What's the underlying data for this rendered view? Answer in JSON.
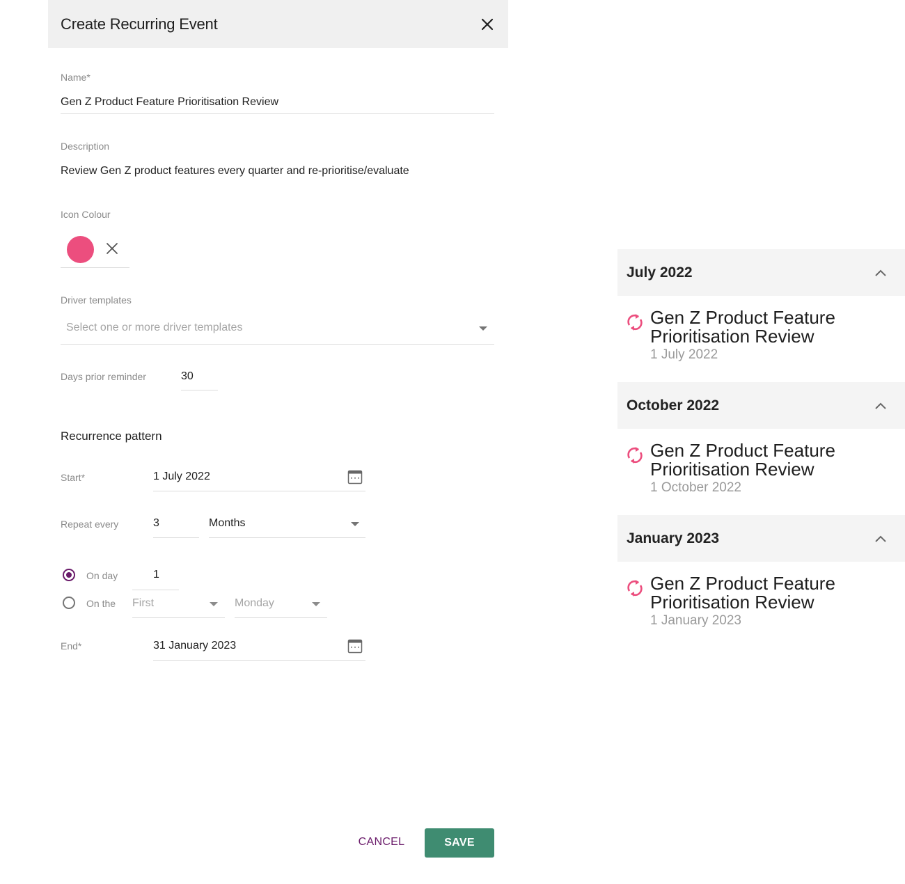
{
  "dialog": {
    "title": "Create Recurring Event",
    "close_icon": "close-icon",
    "name": {
      "label": "Name*",
      "value": "Gen Z Product Feature Prioritisation Review"
    },
    "description": {
      "label": "Description",
      "value": "Review Gen Z product features every quarter and re-prioritise/evaluate"
    },
    "icon_colour": {
      "label": "Icon Colour",
      "value": "#ec4e7e",
      "clear_icon": "close-icon"
    },
    "driver_templates": {
      "label": "Driver templates",
      "placeholder": "Select one or more driver templates"
    },
    "days_prior_reminder": {
      "label": "Days prior reminder",
      "value": "30"
    },
    "recurrence": {
      "title": "Recurrence pattern",
      "start": {
        "label": "Start*",
        "value": "1 July 2022"
      },
      "repeat_every": {
        "label": "Repeat every",
        "value": "3",
        "unit": "Months"
      },
      "on_day": {
        "label": "On day",
        "value": "1",
        "selected": true
      },
      "on_the": {
        "label": "On the",
        "ordinal": "First",
        "weekday": "Monday",
        "selected": false
      },
      "end": {
        "label": "End*",
        "value": "31 January 2023"
      }
    },
    "actions": {
      "cancel": "CANCEL",
      "save": "SAVE"
    },
    "colors": {
      "accent": "#6a1b6a",
      "save": "#3f8c71",
      "header_bg": "#f0f0f0"
    }
  },
  "timeline": {
    "groups": [
      {
        "month": "July 2022",
        "event": {
          "title": "Gen Z Product Feature Prioritisation Review",
          "date": "1 July 2022",
          "icon": "recurring-icon"
        }
      },
      {
        "month": "October 2022",
        "event": {
          "title": "Gen Z Product Feature Prioritisation Review",
          "date": "1 October 2022",
          "icon": "recurring-icon"
        }
      },
      {
        "month": "January 2023",
        "event": {
          "title": "Gen Z Product Feature Prioritisation Review",
          "date": "1 January 2023",
          "icon": "recurring-icon"
        }
      }
    ]
  }
}
